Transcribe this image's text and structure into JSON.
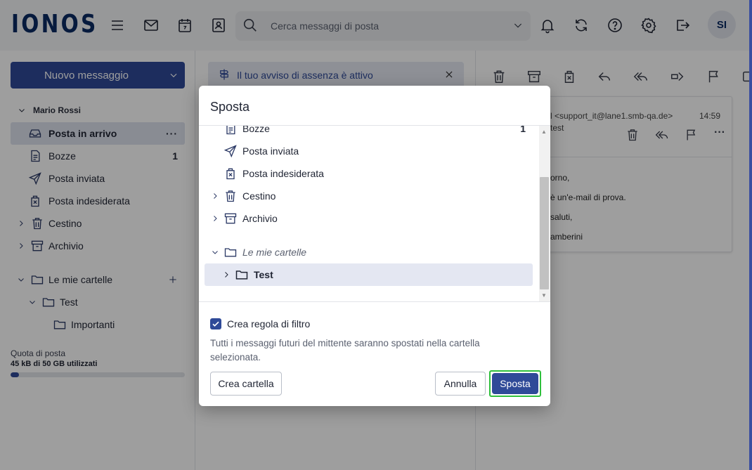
{
  "header": {
    "logo": "IONOS",
    "search_placeholder": "Cerca messaggi di posta",
    "avatar_initials": "SI"
  },
  "sidebar": {
    "new_message_label": "Nuovo messaggio",
    "account_name": "Mario Rossi",
    "folders": [
      {
        "label": "Posta in arrivo",
        "icon": "inbox-icon",
        "active": true
      },
      {
        "label": "Bozze",
        "icon": "draft-icon",
        "count": "1"
      },
      {
        "label": "Posta inviata",
        "icon": "send-icon"
      },
      {
        "label": "Posta indesiderata",
        "icon": "spam-icon"
      },
      {
        "label": "Cestino",
        "icon": "trash-icon"
      },
      {
        "label": "Archivio",
        "icon": "archive-icon"
      }
    ],
    "my_folders_label": "Le mie cartelle",
    "sub_folders": [
      {
        "label": "Test"
      },
      {
        "label": "Importanti"
      }
    ],
    "quota_label": "Quota di posta",
    "quota_value": "45 kB di 50 GB utilizzati",
    "quota_fraction": 0.05
  },
  "middle": {
    "oof_banner": "Il tuo avviso di assenza è attivo"
  },
  "reader": {
    "from_fragment": "l <support_it@lane1.smb-qa.de>",
    "time": "14:59",
    "subject_fragment": "test",
    "body_lines": [
      "orno,",
      "è un'e-mail di prova.",
      "saluti,",
      "amberini"
    ]
  },
  "modal": {
    "title": "Sposta",
    "folders": [
      {
        "label": "Bozze",
        "icon": "draft-icon",
        "count": "1"
      },
      {
        "label": "Posta inviata",
        "icon": "send-icon"
      },
      {
        "label": "Posta indesiderata",
        "icon": "spam-icon"
      },
      {
        "label": "Cestino",
        "icon": "trash-icon",
        "expandable": true
      },
      {
        "label": "Archivio",
        "icon": "archive-icon",
        "expandable": true
      },
      {
        "label": "Le mie cartelle",
        "icon": "folder-icon",
        "expanded": true
      },
      {
        "label": "Test",
        "icon": "folder-icon",
        "expandable": true,
        "selected": true
      }
    ],
    "filter_checkbox_label": "Crea regola di filtro",
    "filter_checked": true,
    "filter_hint": "Tutti i messaggi futuri del mittente saranno spostati nella cartella selezionata.",
    "create_folder_label": "Crea cartella",
    "cancel_label": "Annulla",
    "move_label": "Sposta"
  }
}
